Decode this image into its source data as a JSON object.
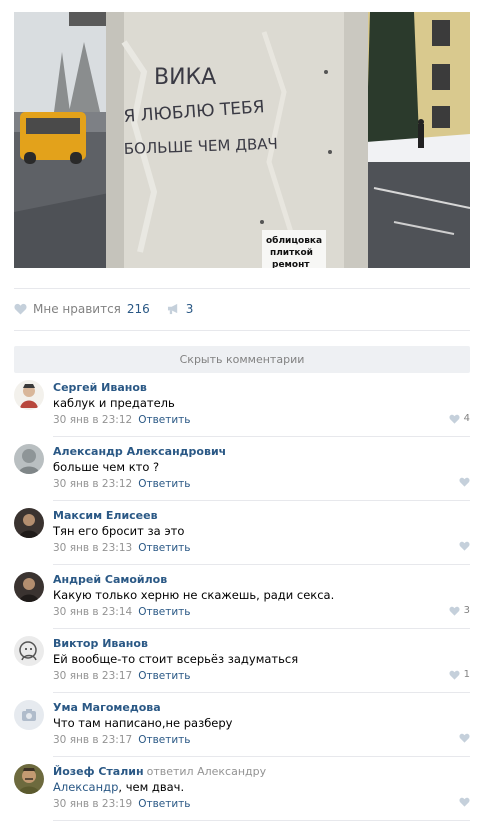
{
  "post": {
    "photo": {
      "graffiti_lines": [
        "ВИКА",
        "Я ЛЮБЛЮ ТЕБЯ",
        "БОЛЬШЕ ЧЕМ ДВАЧ"
      ],
      "sticker_lines": [
        "облицовка",
        "плиткой",
        "ремонт"
      ]
    },
    "like_label": "Мне нравится",
    "like_count": "216",
    "repost_count": "3"
  },
  "comments_toggle": "Скрыть комментарии",
  "comments": [
    {
      "author": "Сергей Иванов",
      "reply_to": "",
      "addressee": "",
      "text": "каблук и предатель",
      "date": "30 янв в 23:12",
      "reply_label": "Ответить",
      "likes": "4",
      "avatar": "drawing"
    },
    {
      "author": "Александр Александрович",
      "reply_to": "",
      "addressee": "",
      "text": "больше чем кто ?",
      "date": "30 янв в 23:12",
      "reply_label": "Ответить",
      "likes": "",
      "avatar": "gray"
    },
    {
      "author": "Максим Елисеев",
      "reply_to": "",
      "addressee": "",
      "text": "Тян его бросит за это",
      "date": "30 янв в 23:13",
      "reply_label": "Ответить",
      "likes": "",
      "avatar": "dark"
    },
    {
      "author": "Андрей Самойлов",
      "reply_to": "",
      "addressee": "",
      "text": "Какую только херню не скажешь, ради секса.",
      "date": "30 янв в 23:14",
      "reply_label": "Ответить",
      "likes": "3",
      "avatar": "dark"
    },
    {
      "author": "Виктор Иванов",
      "reply_to": "",
      "addressee": "",
      "text": "Ей вообще-то стоит всерьёз задуматься",
      "date": "30 янв в 23:17",
      "reply_label": "Ответить",
      "likes": "1",
      "avatar": "sketch"
    },
    {
      "author": "Ума Магомедова",
      "reply_to": "",
      "addressee": "",
      "text": "Что там написано,не разберу",
      "date": "30 янв в 23:17",
      "reply_label": "Ответить",
      "likes": "",
      "avatar": "camera"
    },
    {
      "author": "Йозеф Сталин",
      "reply_to": "ответил Александру",
      "addressee": "Александр",
      "text": ", чем двач.",
      "date": "30 янв в 23:19",
      "reply_label": "Ответить",
      "likes": "",
      "avatar": "portrait"
    }
  ],
  "colors": {
    "link": "#2a5885",
    "meta": "#939393",
    "separator": "#e7e8ec",
    "toggle_bg": "#eef0f3"
  }
}
